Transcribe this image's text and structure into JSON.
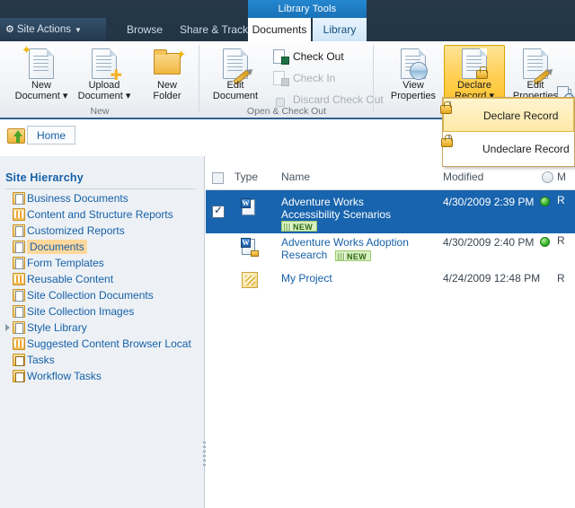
{
  "topbar": {
    "site_actions": "Site Actions",
    "site_actions_icon": "gear-icon",
    "contextual_group": "Library Tools",
    "tabs": [
      {
        "label": "Browse",
        "active": false
      },
      {
        "label": "Share & Track",
        "active": false
      },
      {
        "label": "Documents",
        "active": true
      },
      {
        "label": "Library",
        "active": false
      }
    ]
  },
  "ribbon": {
    "groups": [
      {
        "label": "New"
      },
      {
        "label": "Open & Check Out"
      }
    ],
    "new_document": {
      "line1": "New",
      "line2": "Document",
      "caret": "▾",
      "icon": "new-document-icon"
    },
    "upload_document": {
      "line1": "Upload",
      "line2": "Document",
      "caret": "▾",
      "icon": "upload-document-icon"
    },
    "new_folder": {
      "line1": "New",
      "line2": "Folder",
      "icon": "new-folder-icon"
    },
    "edit_document": {
      "line1": "Edit",
      "line2": "Document",
      "icon": "edit-document-icon"
    },
    "check_out": {
      "label": "Check Out",
      "icon": "check-out-icon",
      "enabled": true
    },
    "check_in": {
      "label": "Check In",
      "icon": "check-in-icon",
      "enabled": false
    },
    "discard_check_out": {
      "label": "Discard Check Out",
      "icon": "discard-check-out-icon",
      "enabled": false
    },
    "view_properties": {
      "line1": "View",
      "line2": "Properties",
      "icon": "view-properties-icon"
    },
    "declare_record": {
      "line1": "Declare",
      "line2": "Record",
      "caret": "▾",
      "icon": "declare-record-icon",
      "selected": true
    },
    "edit_properties": {
      "line1": "Edit",
      "line2": "Properties",
      "icon": "edit-properties-icon"
    },
    "edge_icons": [
      {
        "name": "manage-copies-icon"
      },
      {
        "name": "manage-permissions-icon"
      },
      {
        "name": "delete-document-icon"
      }
    ]
  },
  "dropdown": {
    "items": [
      {
        "label": "Declare Record",
        "icon": "declare-record-icon",
        "highlighted": true
      },
      {
        "label": "Undeclare Record",
        "icon": "undeclare-record-icon",
        "highlighted": false
      }
    ]
  },
  "breadcrumb": {
    "up_icon": "go-up-icon",
    "home": "Home"
  },
  "sidebar": {
    "title": "Site Hierarchy",
    "items": [
      {
        "label": "Business Documents",
        "icon": "document-library-icon",
        "selected": false,
        "expandable": false
      },
      {
        "label": "Content and Structure Reports",
        "icon": "list-icon",
        "selected": false,
        "expandable": false
      },
      {
        "label": "Customized Reports",
        "icon": "document-library-icon",
        "selected": false,
        "expandable": false
      },
      {
        "label": "Documents",
        "icon": "document-library-icon",
        "selected": true,
        "expandable": false
      },
      {
        "label": "Form Templates",
        "icon": "document-library-icon",
        "selected": false,
        "expandable": false
      },
      {
        "label": "Reusable Content",
        "icon": "list-icon",
        "selected": false,
        "expandable": false
      },
      {
        "label": "Site Collection Documents",
        "icon": "document-library-icon",
        "selected": false,
        "expandable": false
      },
      {
        "label": "Site Collection Images",
        "icon": "document-library-icon",
        "selected": false,
        "expandable": false
      },
      {
        "label": "Style Library",
        "icon": "document-library-icon",
        "selected": false,
        "expandable": true
      },
      {
        "label": "Suggested Content Browser Locat",
        "icon": "list-icon",
        "selected": false,
        "expandable": false
      },
      {
        "label": "Tasks",
        "icon": "task-list-icon",
        "selected": false,
        "expandable": false
      },
      {
        "label": "Workflow Tasks",
        "icon": "task-list-icon",
        "selected": false,
        "expandable": false
      }
    ]
  },
  "list": {
    "columns": [
      "Type",
      "Name",
      "Modified",
      "M"
    ],
    "rows": [
      {
        "name_line1": "Adventure Works",
        "name_line2": "Accessibility Scenarios",
        "badge": "NEW",
        "modified": "4/30/2009 2:39 PM",
        "status": "R",
        "type_icon": "word-document-icon",
        "selected": true,
        "checked": true
      },
      {
        "name_line1": "Adventure Works Adoption",
        "name_line2": "Research",
        "badge": "NEW",
        "modified": "4/30/2009 2:40 PM",
        "status": "R",
        "type_icon": "word-document-checked-out-icon",
        "selected": false,
        "checked": false
      },
      {
        "name_line1": "My Project",
        "name_line2": "",
        "badge": "",
        "modified": "4/24/2009 12:48 PM",
        "status": "R",
        "type_icon": "project-document-icon",
        "selected": false,
        "checked": false
      }
    ]
  },
  "colors": {
    "chrome_dark": "#21374c",
    "accent_blue": "#1f7cc4",
    "selection_blue": "#1864ae",
    "highlight_gold": "#ffcf52",
    "link_blue": "#1560a8",
    "status_green": "#35b12b"
  }
}
